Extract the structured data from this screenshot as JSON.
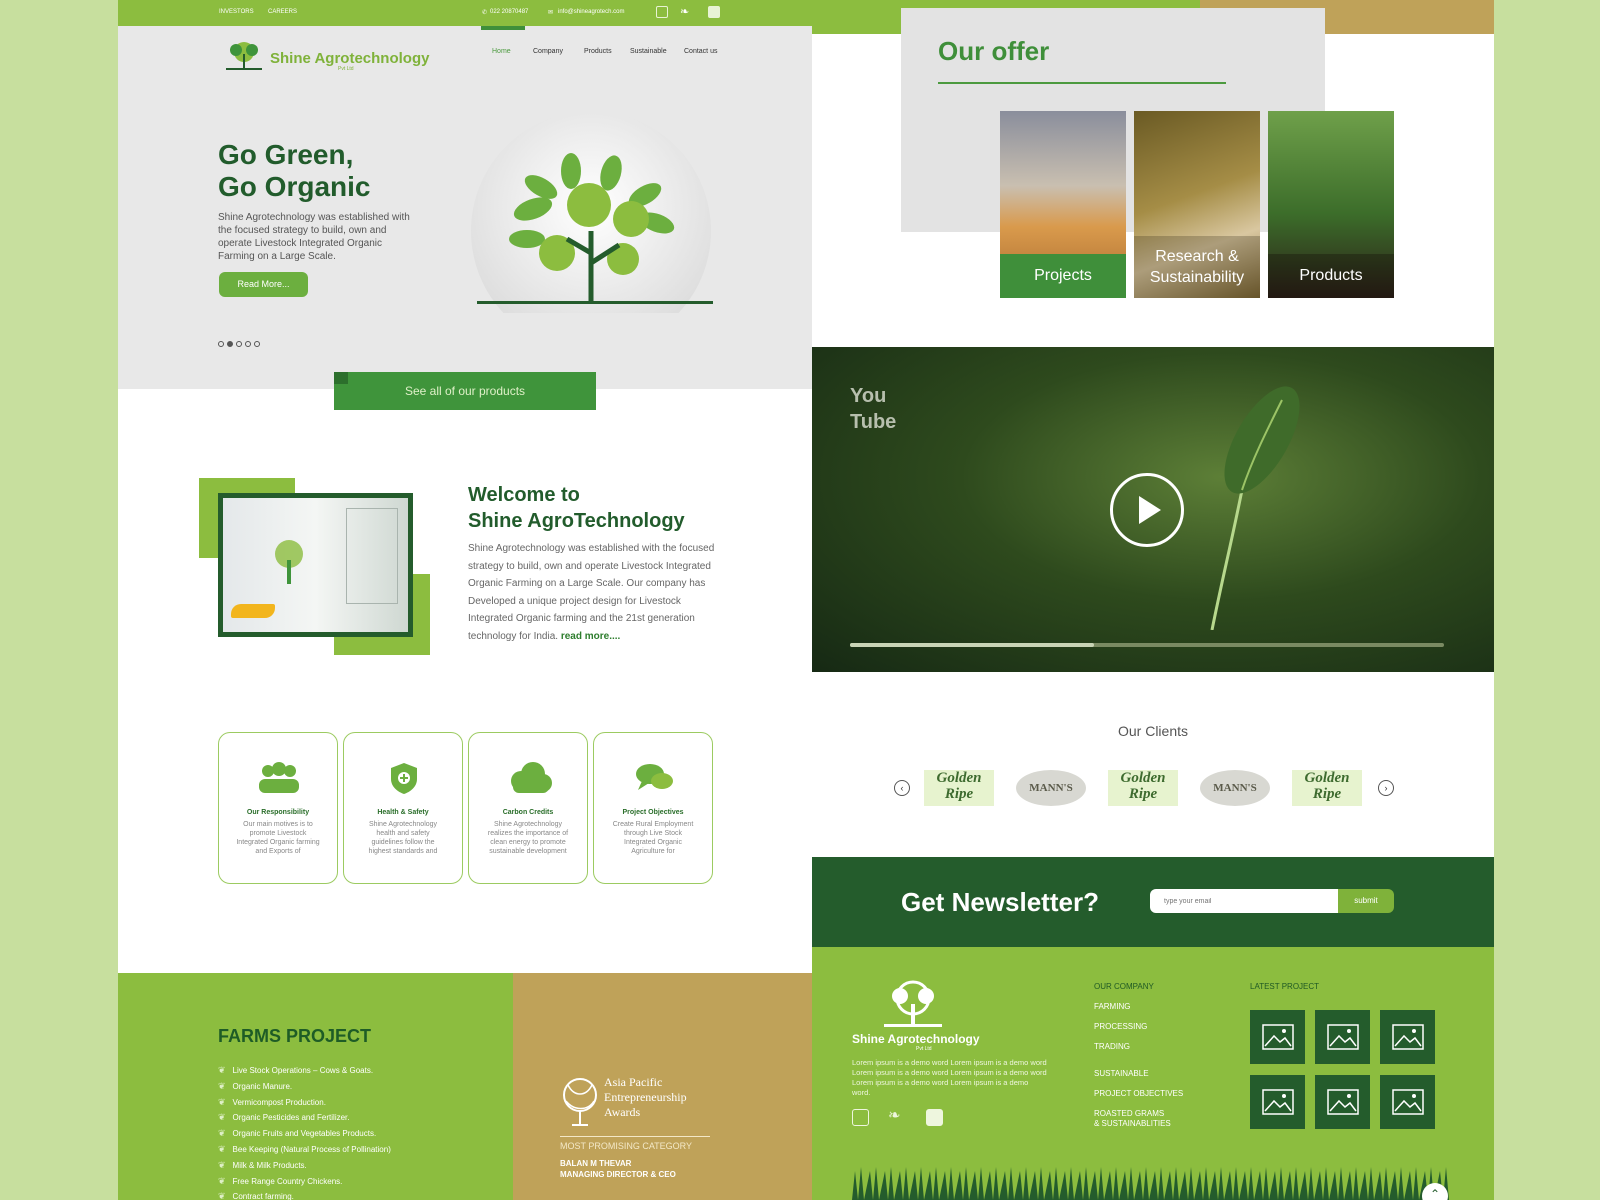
{
  "topbar": {
    "investors": "INVESTORS",
    "careers": "CAREERS",
    "phone": "022 20870487",
    "email": "info@shineagrotech.com"
  },
  "brand": {
    "name": "Shine Agrotechnology",
    "sub": "Pvt Ltd"
  },
  "nav": [
    "Home",
    "Company",
    "Products",
    "Sustainable",
    "Contact us"
  ],
  "hero": {
    "title_line1": "Go Green,",
    "title_line2": "Go Organic",
    "description": "Shine Agrotechnology was established with the focused strategy to build, own and operate Livestock Integrated Organic Farming on a Large Scale.",
    "button": "Read More...",
    "active_slide": 2,
    "slide_count": 5
  },
  "see_all": "See all of our products",
  "welcome": {
    "title_line1": "Welcome to",
    "title_line2": "Shine AgroTechnology",
    "body": "Shine Agrotechnology was established with the focused strategy to build, own and operate Livestock Integrated Organic Farming on a Large Scale. Our company has Developed a unique project design for Livestock Integrated Organic farming and the 21st generation technology for India.",
    "read_more": "read more...."
  },
  "cards": [
    {
      "icon": "people-icon",
      "title": "Our Responsibility",
      "desc": "Our main motives is to promote Livestock Integrated Organic farming and Exports of"
    },
    {
      "icon": "shield-icon",
      "title": "Health & Safety",
      "desc": "Shine Agrotechnology health and safety guidelines follow the highest standards and"
    },
    {
      "icon": "cloud-icon",
      "title": "Carbon Credits",
      "desc": "Shine Agrotechnology realizes the importance of clean energy to promote sustainable development"
    },
    {
      "icon": "chat-icon",
      "title": "Project Objectives",
      "desc": "Create Rural Employment through Live Stock Integrated Organic Agriculture for"
    }
  ],
  "farms": {
    "title": "FARMS PROJECT",
    "items": [
      "Live Stock Operations – Cows & Goats.",
      "Organic Manure.",
      "Vermicompost Production.",
      "Organic Pesticides and Fertilizer.",
      "Organic Fruits and Vegetables Products.",
      "Bee Keeping (Natural Process of Pollination)",
      "Milk & Milk Products.",
      "Free Range Country Chickens.",
      "Contract farming."
    ]
  },
  "awards": {
    "line1": "Asia Pacific",
    "line2": "Entrepreneurship",
    "line3": "Awards",
    "category": "MOST PROMISING CATEGORY",
    "name": "BALAN M THEVAR",
    "role": "MANAGING DIRECTOR & CEO"
  },
  "offer": {
    "title": "Our offer",
    "tiles": [
      "Projects",
      "Research & Sustainability",
      "Products"
    ]
  },
  "video": {
    "logo_top": "You",
    "logo_bottom": "Tube",
    "progress": 0.41
  },
  "clients": {
    "title": "Our Clients",
    "logos": [
      "Golden Ripe",
      "MANN'S",
      "Golden Ripe",
      "MANN'S",
      "Golden Ripe"
    ]
  },
  "newsletter": {
    "title": "Get Newsletter?",
    "placeholder": "type your email",
    "button": "submit"
  },
  "footer": {
    "brand": "Shine Agrotechnology",
    "brand_sub": "Pvt Ltd",
    "desc": "Lorem ipsum is a demo word Lorem ipsum is a demo word Lorem ipsum is a demo word Lorem ipsum is a demo word Lorem ipsum is a demo word Lorem ipsum is a demo word.",
    "links": [
      "OUR COMPANY",
      "FARMING",
      "PROCESSING",
      "TRADING",
      "SUSTAINABLE",
      "PROJECT OBJECTIVES",
      "ROASTED GRAMS",
      "& SUSTAINABLITIES"
    ],
    "latest_title": "LATEST PROJECT"
  },
  "colors": {
    "brand_green": "#8cbd3f",
    "dark_green": "#245c2c",
    "gold": "#bfa259",
    "page_bg": "#c7df9e"
  }
}
